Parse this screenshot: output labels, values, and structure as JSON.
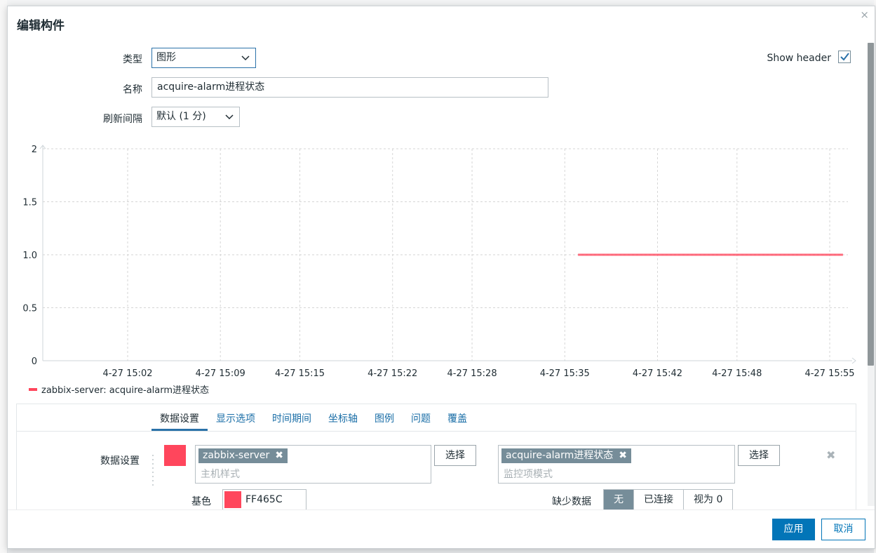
{
  "dialog": {
    "title": "编辑构件",
    "close_glyph": "×"
  },
  "form": {
    "type_label": "类型",
    "type_value": "图形",
    "name_label": "名称",
    "name_value": "acquire-alarm进程状态",
    "refresh_label": "刷新间隔",
    "refresh_value": "默认 (1 分)",
    "show_header_label": "Show header",
    "show_header_checked": true
  },
  "chart_data": {
    "type": "line",
    "x_ticks": [
      "4-27 15:02",
      "4-27 15:09",
      "4-27 15:15",
      "4-27 15:22",
      "4-27 15:28",
      "4-27 15:35",
      "4-27 15:42",
      "4-27 15:48",
      "4-27 15:55"
    ],
    "y_ticks": [
      "0",
      "0.5",
      "1.0",
      "1.5",
      "2"
    ],
    "ylim": [
      0,
      2
    ],
    "grid": true,
    "series": [
      {
        "name": "zabbix-server: acquire-alarm进程状态",
        "color": "#ff465c",
        "x": [
          "4-27 15:36",
          "4-27 15:56"
        ],
        "values": [
          1.0,
          1.0
        ]
      }
    ]
  },
  "tabs": [
    {
      "label": "数据设置",
      "active": true
    },
    {
      "label": "显示选项",
      "active": false
    },
    {
      "label": "时间期间",
      "active": false
    },
    {
      "label": "坐标轴",
      "active": false
    },
    {
      "label": "图例",
      "active": false
    },
    {
      "label": "问题",
      "active": false
    },
    {
      "label": "覆盖",
      "active": false
    }
  ],
  "dataset": {
    "label": "数据设置",
    "host_chip": "zabbix-server",
    "host_placeholder": "主机样式",
    "item_chip": "acquire-alarm进程状态",
    "item_placeholder": "监控项模式",
    "select_label": "选择",
    "chip_remove": "✖",
    "row_remove": "✖",
    "base_color_label": "基色",
    "base_color_value": "FF465C",
    "missing_label": "缺少数据",
    "missing_options": [
      "无",
      "已连接",
      "视为 0"
    ]
  },
  "footer": {
    "apply": "应用",
    "cancel": "取消"
  }
}
